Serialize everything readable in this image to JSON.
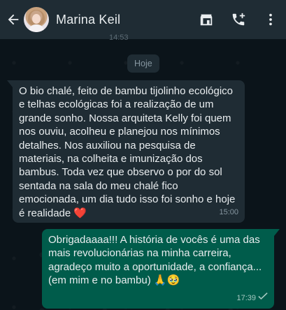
{
  "header": {
    "contact_name": "Marina Keil",
    "icons": [
      "back-arrow-icon",
      "avatar",
      "store-icon",
      "add-call-icon",
      "more-vert-icon"
    ]
  },
  "chat": {
    "prev_time": "14:53",
    "date_chip": "Hoje",
    "messages": [
      {
        "direction": "incoming",
        "text": "O bio chalé, feito de bambu tijolinho ecológico e telhas ecológicas foi a realização de um grande sonho. Nossa arquiteta Kelly foi quem nos ouviu, acolheu e planejou nos mínimos detalhes. Nos auxiliou na pesquisa de materiais, na colheita e imunização dos bambus. Toda vez que observo o por do sol sentada na sala do meu chalé fico emocionada, um dia tudo isso foi sonho e hoje é realidade",
        "emoji": "❤️",
        "time": "15:00"
      },
      {
        "direction": "outgoing",
        "text": "Obrigadaaaa!!! A história de vocês é uma das mais revolucionárias na minha carreira, agradeço muito a oportunidade, a confiança... (em mim e no bambu)",
        "emoji": "🙏🥹",
        "time": "17:39",
        "status": "sent-check-icon"
      }
    ]
  },
  "colors": {
    "header_bg": "#1f2c34",
    "chat_bg": "#0b141a",
    "incoming_bubble": "#1f2c34",
    "outgoing_bubble": "#005c4b",
    "meta_text": "#8696a0"
  }
}
